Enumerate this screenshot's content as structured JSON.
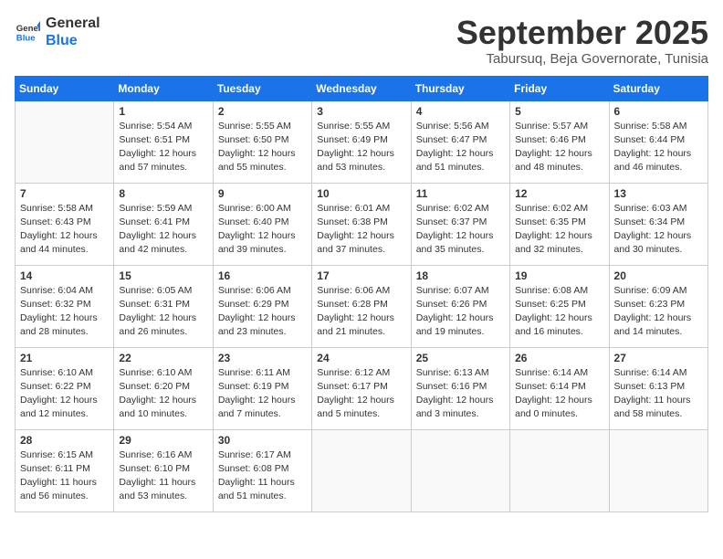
{
  "logo": {
    "line1": "General",
    "line2": "Blue",
    "icon_color": "#1a73e8"
  },
  "header": {
    "month": "September 2025",
    "location": "Tabursuq, Beja Governorate, Tunisia"
  },
  "weekdays": [
    "Sunday",
    "Monday",
    "Tuesday",
    "Wednesday",
    "Thursday",
    "Friday",
    "Saturday"
  ],
  "weeks": [
    [
      {
        "day": "",
        "info": ""
      },
      {
        "day": "1",
        "info": "Sunrise: 5:54 AM\nSunset: 6:51 PM\nDaylight: 12 hours\nand 57 minutes."
      },
      {
        "day": "2",
        "info": "Sunrise: 5:55 AM\nSunset: 6:50 PM\nDaylight: 12 hours\nand 55 minutes."
      },
      {
        "day": "3",
        "info": "Sunrise: 5:55 AM\nSunset: 6:49 PM\nDaylight: 12 hours\nand 53 minutes."
      },
      {
        "day": "4",
        "info": "Sunrise: 5:56 AM\nSunset: 6:47 PM\nDaylight: 12 hours\nand 51 minutes."
      },
      {
        "day": "5",
        "info": "Sunrise: 5:57 AM\nSunset: 6:46 PM\nDaylight: 12 hours\nand 48 minutes."
      },
      {
        "day": "6",
        "info": "Sunrise: 5:58 AM\nSunset: 6:44 PM\nDaylight: 12 hours\nand 46 minutes."
      }
    ],
    [
      {
        "day": "7",
        "info": "Sunrise: 5:58 AM\nSunset: 6:43 PM\nDaylight: 12 hours\nand 44 minutes."
      },
      {
        "day": "8",
        "info": "Sunrise: 5:59 AM\nSunset: 6:41 PM\nDaylight: 12 hours\nand 42 minutes."
      },
      {
        "day": "9",
        "info": "Sunrise: 6:00 AM\nSunset: 6:40 PM\nDaylight: 12 hours\nand 39 minutes."
      },
      {
        "day": "10",
        "info": "Sunrise: 6:01 AM\nSunset: 6:38 PM\nDaylight: 12 hours\nand 37 minutes."
      },
      {
        "day": "11",
        "info": "Sunrise: 6:02 AM\nSunset: 6:37 PM\nDaylight: 12 hours\nand 35 minutes."
      },
      {
        "day": "12",
        "info": "Sunrise: 6:02 AM\nSunset: 6:35 PM\nDaylight: 12 hours\nand 32 minutes."
      },
      {
        "day": "13",
        "info": "Sunrise: 6:03 AM\nSunset: 6:34 PM\nDaylight: 12 hours\nand 30 minutes."
      }
    ],
    [
      {
        "day": "14",
        "info": "Sunrise: 6:04 AM\nSunset: 6:32 PM\nDaylight: 12 hours\nand 28 minutes."
      },
      {
        "day": "15",
        "info": "Sunrise: 6:05 AM\nSunset: 6:31 PM\nDaylight: 12 hours\nand 26 minutes."
      },
      {
        "day": "16",
        "info": "Sunrise: 6:06 AM\nSunset: 6:29 PM\nDaylight: 12 hours\nand 23 minutes."
      },
      {
        "day": "17",
        "info": "Sunrise: 6:06 AM\nSunset: 6:28 PM\nDaylight: 12 hours\nand 21 minutes."
      },
      {
        "day": "18",
        "info": "Sunrise: 6:07 AM\nSunset: 6:26 PM\nDaylight: 12 hours\nand 19 minutes."
      },
      {
        "day": "19",
        "info": "Sunrise: 6:08 AM\nSunset: 6:25 PM\nDaylight: 12 hours\nand 16 minutes."
      },
      {
        "day": "20",
        "info": "Sunrise: 6:09 AM\nSunset: 6:23 PM\nDaylight: 12 hours\nand 14 minutes."
      }
    ],
    [
      {
        "day": "21",
        "info": "Sunrise: 6:10 AM\nSunset: 6:22 PM\nDaylight: 12 hours\nand 12 minutes."
      },
      {
        "day": "22",
        "info": "Sunrise: 6:10 AM\nSunset: 6:20 PM\nDaylight: 12 hours\nand 10 minutes."
      },
      {
        "day": "23",
        "info": "Sunrise: 6:11 AM\nSunset: 6:19 PM\nDaylight: 12 hours\nand 7 minutes."
      },
      {
        "day": "24",
        "info": "Sunrise: 6:12 AM\nSunset: 6:17 PM\nDaylight: 12 hours\nand 5 minutes."
      },
      {
        "day": "25",
        "info": "Sunrise: 6:13 AM\nSunset: 6:16 PM\nDaylight: 12 hours\nand 3 minutes."
      },
      {
        "day": "26",
        "info": "Sunrise: 6:14 AM\nSunset: 6:14 PM\nDaylight: 12 hours\nand 0 minutes."
      },
      {
        "day": "27",
        "info": "Sunrise: 6:14 AM\nSunset: 6:13 PM\nDaylight: 11 hours\nand 58 minutes."
      }
    ],
    [
      {
        "day": "28",
        "info": "Sunrise: 6:15 AM\nSunset: 6:11 PM\nDaylight: 11 hours\nand 56 minutes."
      },
      {
        "day": "29",
        "info": "Sunrise: 6:16 AM\nSunset: 6:10 PM\nDaylight: 11 hours\nand 53 minutes."
      },
      {
        "day": "30",
        "info": "Sunrise: 6:17 AM\nSunset: 6:08 PM\nDaylight: 11 hours\nand 51 minutes."
      },
      {
        "day": "",
        "info": ""
      },
      {
        "day": "",
        "info": ""
      },
      {
        "day": "",
        "info": ""
      },
      {
        "day": "",
        "info": ""
      }
    ]
  ]
}
